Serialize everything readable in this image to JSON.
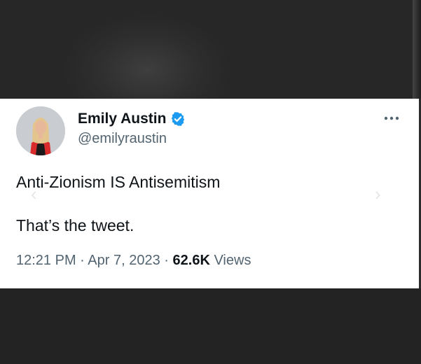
{
  "author": {
    "display_name": "Emily Austin",
    "handle": "@emilyraustin",
    "verified": true
  },
  "tweet": {
    "lines": [
      "Anti-Zionism IS Antisemitism",
      "That’s the tweet."
    ]
  },
  "meta": {
    "time": "12:21 PM",
    "separator": "·",
    "date": "Apr 7, 2023",
    "views_count": "62.6K",
    "views_label": "Views"
  },
  "icons": {
    "more": "more-options-icon",
    "verified": "verified-badge-icon"
  },
  "colors": {
    "verified_blue": "#1d9bf0",
    "text_primary": "#0f1419",
    "text_secondary": "#536471"
  }
}
